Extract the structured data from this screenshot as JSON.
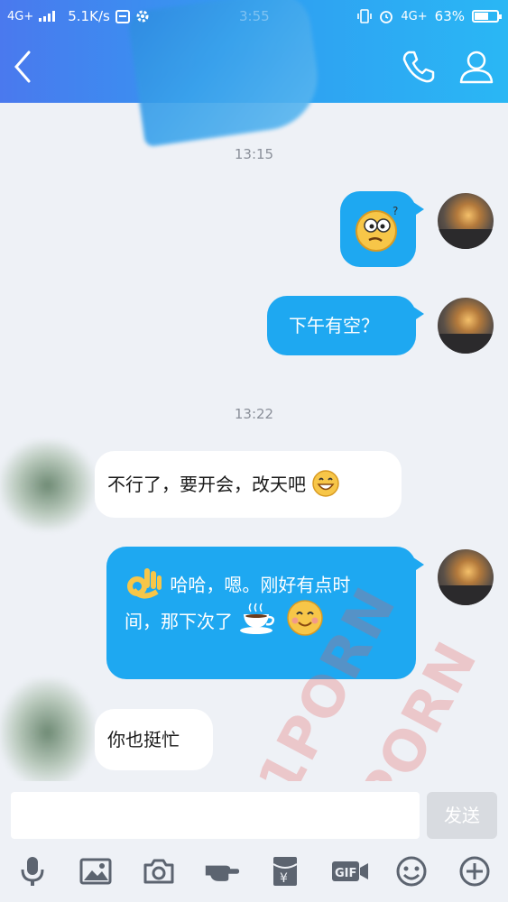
{
  "status_bar": {
    "network_left": "4G+",
    "speed": "5.1K/s",
    "time": "3:55",
    "network_right": "4G+",
    "battery_label": "63%",
    "battery_level": 0.63
  },
  "messages": [
    {
      "type": "timestamp",
      "text": "13:15"
    },
    {
      "type": "out",
      "emoji": "confused-face-emoji"
    },
    {
      "type": "out",
      "text": "下午有空？"
    },
    {
      "type": "timestamp",
      "text": "13:22"
    },
    {
      "type": "in",
      "text": "不行了，要开会，改天吧",
      "emoji": "grinning-face-emoji"
    },
    {
      "type": "out",
      "text_line1": "哈哈，嗯。刚好有点时",
      "text_line2": "间，那下次了",
      "emojis": [
        "ok-hand-emoji",
        "coffee-emoji",
        "smiling-face-emoji"
      ]
    },
    {
      "type": "in",
      "text": "你也挺忙"
    }
  ],
  "input": {
    "value": "",
    "send_label": "发送"
  },
  "toolbar": [
    "microphone-icon",
    "image-icon",
    "camera-icon",
    "hand-icon",
    "red-packet-icon",
    "gif-icon",
    "emoji-icon",
    "plus-icon"
  ],
  "watermark": "91PORN",
  "colors": {
    "accent": "#1ea8f1",
    "header": "#2fa0f2",
    "background": "#eef1f6"
  }
}
